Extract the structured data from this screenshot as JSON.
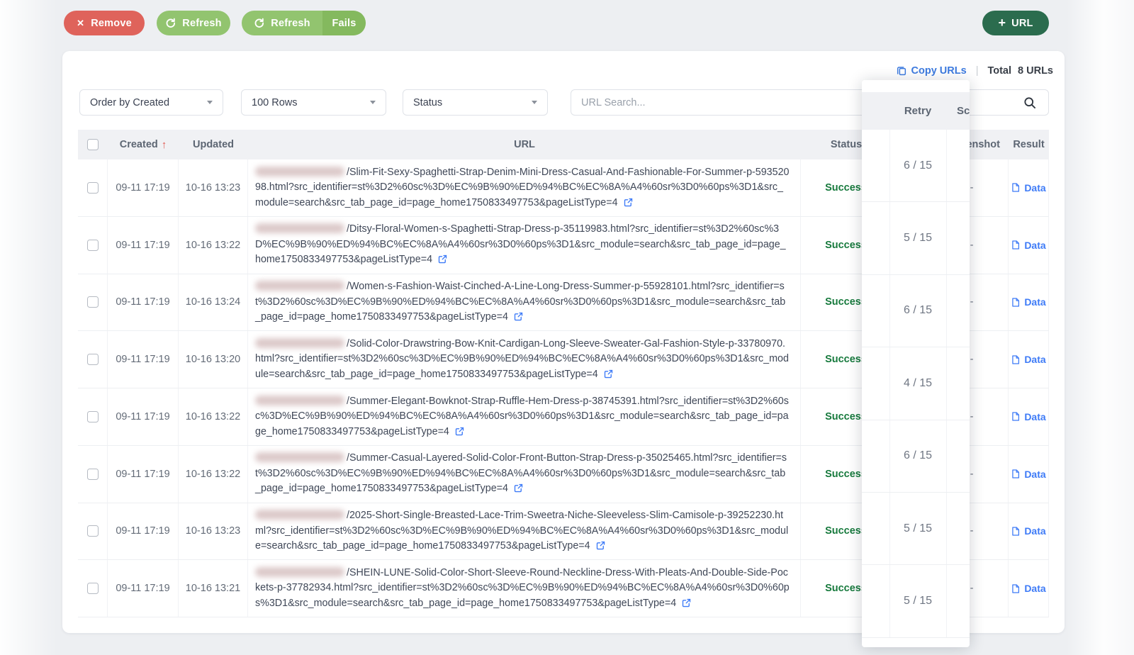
{
  "toolbar": {
    "remove_label": "Remove",
    "refresh_label": "Refresh",
    "refresh_fails_refresh_label": "Refresh",
    "refresh_fails_fails_label": "Fails",
    "add_url_label": "URL"
  },
  "summary": {
    "copy_urls_label": "Copy URLs",
    "separator": "|",
    "total_label": "Total",
    "total_value": "8 URLs"
  },
  "filters": {
    "order_select_value": "Order by Created",
    "rows_select_value": "100 Rows",
    "status_select_value": "Status",
    "search_placeholder": "URL Search..."
  },
  "table": {
    "columns": {
      "created": "Created",
      "sort_indicator": "↑",
      "updated": "Updated",
      "url": "URL",
      "status": "Status",
      "retry": "Retry",
      "screenshot": "Screenshot",
      "result": "Result"
    },
    "rows": [
      {
        "created": "09-11 17:19",
        "updated": "10-16 13:23",
        "url": "/Slim-Fit-Sexy-Spaghetti-Strap-Denim-Mini-Dress-Casual-And-Fashionable-For-Summer-p-59352098.html?src_identifier=st%3D2%60sc%3D%EC%9B%90%ED%94%BC%EC%8A%A4%60sr%3D0%60ps%3D1&src_module=search&src_tab_page_id=page_home1750833497753&pageListType=4",
        "status": "Success",
        "retry": "",
        "screenshot": "-",
        "result": "Data"
      },
      {
        "created": "09-11 17:19",
        "updated": "10-16 13:22",
        "url": "/Ditsy-Floral-Women-s-Spaghetti-Strap-Dress-p-35119983.html?src_identifier=st%3D2%60sc%3D%EC%9B%90%ED%94%BC%EC%8A%A4%60sr%3D0%60ps%3D1&src_module=search&src_tab_page_id=page_home1750833497753&pageListType=4",
        "status": "Success",
        "retry": "",
        "screenshot": "-",
        "result": "Data"
      },
      {
        "created": "09-11 17:19",
        "updated": "10-16 13:24",
        "url": "/Women-s-Fashion-Waist-Cinched-A-Line-Long-Dress-Summer-p-55928101.html?src_identifier=st%3D2%60sc%3D%EC%9B%90%ED%94%BC%EC%8A%A4%60sr%3D0%60ps%3D1&src_module=search&src_tab_page_id=page_home1750833497753&pageListType=4",
        "status": "Success",
        "retry": "",
        "screenshot": "-",
        "result": "Data"
      },
      {
        "created": "09-11 17:19",
        "updated": "10-16 13:20",
        "url": "/Solid-Color-Drawstring-Bow-Knit-Cardigan-Long-Sleeve-Sweater-Gal-Fashion-Style-p-33780970.html?src_identifier=st%3D2%60sc%3D%EC%9B%90%ED%94%BC%EC%8A%A4%60sr%3D0%60ps%3D1&src_module=search&src_tab_page_id=page_home1750833497753&pageListType=4",
        "status": "Success",
        "retry": "",
        "screenshot": "-",
        "result": "Data"
      },
      {
        "created": "09-11 17:19",
        "updated": "10-16 13:22",
        "url": "/Summer-Elegant-Bowknot-Strap-Ruffle-Hem-Dress-p-38745391.html?src_identifier=st%3D2%60sc%3D%EC%9B%90%ED%94%BC%EC%8A%A4%60sr%3D0%60ps%3D1&src_module=search&src_tab_page_id=page_home1750833497753&pageListType=4",
        "status": "Success",
        "retry": "",
        "screenshot": "-",
        "result": "Data"
      },
      {
        "created": "09-11 17:19",
        "updated": "10-16 13:22",
        "url": "/Summer-Casual-Layered-Solid-Color-Front-Button-Strap-Dress-p-35025465.html?src_identifier=st%3D2%60sc%3D%EC%9B%90%ED%94%BC%EC%8A%A4%60sr%3D0%60ps%3D1&src_module=search&src_tab_page_id=page_home1750833497753&pageListType=4",
        "status": "Success",
        "retry": "",
        "screenshot": "-",
        "result": "Data"
      },
      {
        "created": "09-11 17:19",
        "updated": "10-16 13:23",
        "url": "/2025-Short-Single-Breasted-Lace-Trim-Sweetra-Niche-Sleeveless-Slim-Camisole-p-39252230.html?src_identifier=st%3D2%60sc%3D%EC%9B%90%ED%94%BC%EC%8A%A4%60sr%3D0%60ps%3D1&src_module=search&src_tab_page_id=page_home1750833497753&pageListType=4",
        "status": "Success",
        "retry": "",
        "screenshot": "-",
        "result": "Data"
      },
      {
        "created": "09-11 17:19",
        "updated": "10-16 13:21",
        "url": "/SHEIN-LUNE-Solid-Color-Short-Sleeve-Round-Neckline-Dress-With-Pleats-And-Double-Side-Pockets-p-37782934.html?src_identifier=st%3D2%60sc%3D%EC%9B%90%ED%94%BC%EC%8A%A4%60sr%3D0%60ps%3D1&src_module=search&src_tab_page_id=page_home1750833497753&pageListType=4",
        "status": "Success",
        "retry": "",
        "screenshot": "-",
        "result": "Data"
      }
    ]
  },
  "ghost_panel": {
    "retry_header": "Retry",
    "screenshot_header": "Screenshot",
    "values": [
      "6 / 15",
      "5 / 15",
      "6 / 15",
      "4 / 15",
      "6 / 15",
      "5 / 15",
      "5 / 15"
    ]
  },
  "colors": {
    "accent_red": "#df635b",
    "accent_green": "#92c46f",
    "accent_green_dark_segment": "#84b95e",
    "accent_url_button": "#2b6c4e",
    "link_blue": "#3e7bf7",
    "copy_blue": "#3d7be0",
    "success_green": "#177a3d",
    "sort_arrow_red": "#e05a52",
    "header_bg": "#f0f1f4",
    "page_bg": "#edeff2"
  }
}
